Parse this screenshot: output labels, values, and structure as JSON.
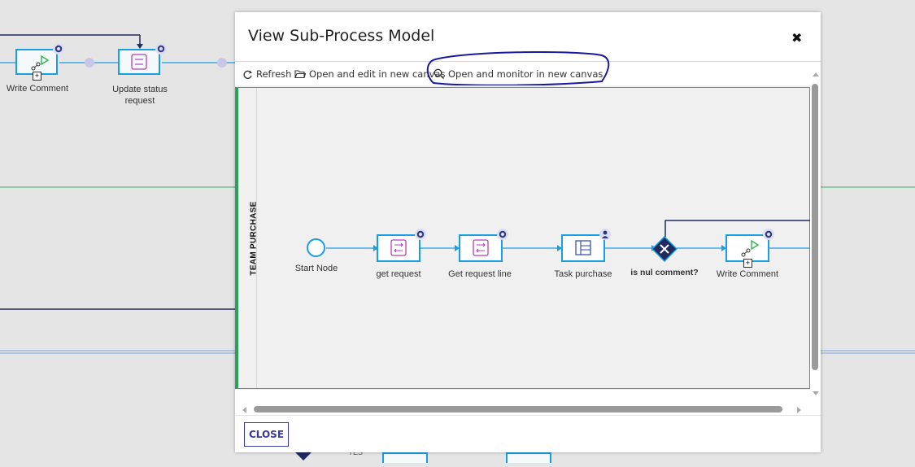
{
  "background": {
    "nodes": [
      {
        "label": "Write Comment"
      },
      {
        "label": "Update status request"
      }
    ],
    "bottom_label": "YES"
  },
  "modal": {
    "title": "View Sub-Process Model",
    "close_icon": "close-icon",
    "toolbar": {
      "refresh_label": "Refresh",
      "open_edit_label": "Open and edit in new canvas",
      "open_monitor_label": "Open and monitor in new canvas"
    },
    "lane": {
      "label": "TEAM PURCHASE"
    },
    "nodes": [
      {
        "label": "Start Node",
        "kind": "start-event"
      },
      {
        "label": "get request",
        "kind": "script-task",
        "badge": "gear-icon"
      },
      {
        "label": "Get request line",
        "kind": "script-task",
        "badge": "gear-icon"
      },
      {
        "label": "Task purchase",
        "kind": "user-task",
        "badge": "person-icon"
      },
      {
        "label": "is nul comment?",
        "kind": "exclusive-gateway"
      },
      {
        "label": "Write Comment",
        "kind": "subprocess-task",
        "badge": "gear-icon"
      }
    ],
    "footer": {
      "close_label": "CLOSE"
    }
  },
  "colors": {
    "accent": "#1a9ee0",
    "lane_border": "#2e9e5e",
    "annotation": "#1a1aa0",
    "button": "#3a3a9a"
  }
}
